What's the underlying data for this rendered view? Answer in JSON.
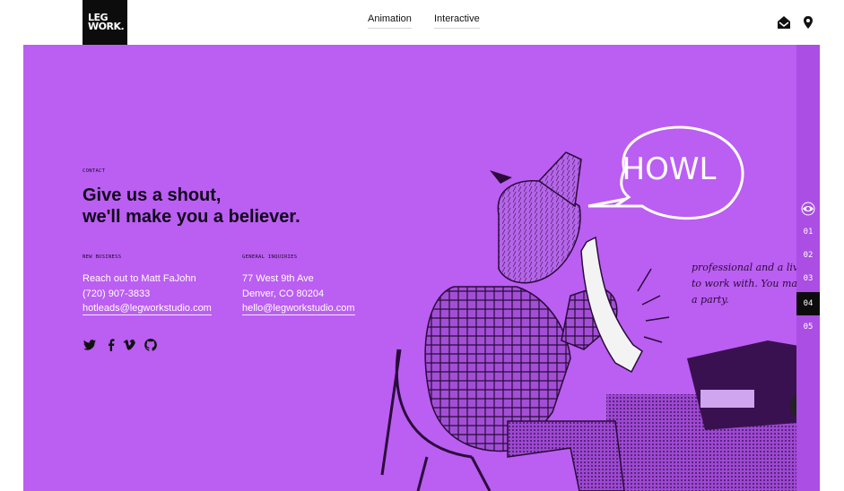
{
  "header": {
    "logo_line1": "LEG",
    "logo_line2": "WORK.",
    "nav": [
      "Animation",
      "Interactive"
    ]
  },
  "icons": {
    "mail": "envelope-icon",
    "location": "map-pin-icon",
    "twitter": "twitter-icon",
    "facebook": "facebook-icon",
    "vimeo": "vimeo-icon",
    "github": "github-icon",
    "sidebar_top": "eye-icon"
  },
  "contact": {
    "eyebrow": "CONTACT",
    "headline_1": "Give us a shout,",
    "headline_2": "we'll make you a believer.",
    "new_business": {
      "label": "NEW BUSINESS",
      "line1": "Reach out to Matt FaJohn",
      "phone": "(720) 907-3833",
      "email": "hotleads@legworkstudio.com"
    },
    "general": {
      "label": "GENERAL INQUIRIES",
      "address1": "77 West 9th Ave",
      "address2": "Denver, CO 80204",
      "email": "hello@legworkstudio.com"
    }
  },
  "illustration": {
    "bubble_text": "HOWL",
    "note_text_1": "professional and a living",
    "note_text_2": "to work with. You make",
    "note_text_3": "a party."
  },
  "pager": [
    "01",
    "02",
    "03",
    "04",
    "05"
  ],
  "pager_active": "04",
  "colors": {
    "hero_bg": "#bb5ef2",
    "sidebar_bg": "#ab4ee4",
    "logo_bg": "#0c0c0c",
    "text_dark": "#10061a"
  }
}
